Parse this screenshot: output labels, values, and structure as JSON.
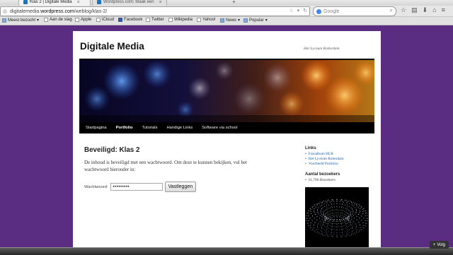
{
  "browser": {
    "tabs": [
      {
        "label": "Klas 2 | Digitale Media",
        "active": true
      },
      {
        "label": "Wordpress.com: Maak een",
        "active": false
      }
    ],
    "url": {
      "prefix": "digitalemedia.",
      "host": "wordpress.com",
      "path": "/weblog/klas-2/"
    },
    "search_placeholder": "Google",
    "bookmarks": [
      {
        "label": "Meest bezocht",
        "icon": "most-visited-icon",
        "has_menu": true
      },
      {
        "label": "Aan de slag",
        "icon": "page-icon"
      },
      {
        "label": "Apple",
        "icon": "page-icon"
      },
      {
        "label": "iCloud",
        "icon": "page-icon"
      },
      {
        "label": "Facebook",
        "icon": "facebook-icon"
      },
      {
        "label": "Twitter",
        "icon": "page-icon"
      },
      {
        "label": "Wikipedia",
        "icon": "page-icon"
      },
      {
        "label": "Yahoo!",
        "icon": "page-icon"
      },
      {
        "label": "News",
        "icon": "folder-icon",
        "has_menu": true
      },
      {
        "label": "Popular",
        "icon": "folder-icon",
        "has_menu": true
      }
    ]
  },
  "site": {
    "title": "Digitale Media",
    "description": "Het Lyceum Rotterdam",
    "menu": [
      "Startpagina",
      "Portfolio",
      "Tutorials",
      "Handige Links",
      "Software via school"
    ],
    "active_menu": "Portfolio"
  },
  "post": {
    "title": "Beveiligd: Klas 2",
    "text": "De inhoud is beveiligd met een wachtwoord. Om deze te kunnen bekijken, vul het wachtwoord hieronder in:",
    "password_label": "Wachtwoord:",
    "password_value": "•••••••••",
    "submit_label": "Vastleggen"
  },
  "sidebar": {
    "links_title": "Links",
    "links": [
      "Fotoalbum HLR",
      "Het Lyceum Rotterdam",
      "Voorbeeld Portfolio"
    ],
    "stats_title": "Aantal bezoekers",
    "stats_value": "61,786 Bezoekers"
  },
  "follow_label": "Volg",
  "colors": {
    "page_background": "#5a2d82",
    "link": "#1b5ea8",
    "menu_bar": "#000000"
  }
}
